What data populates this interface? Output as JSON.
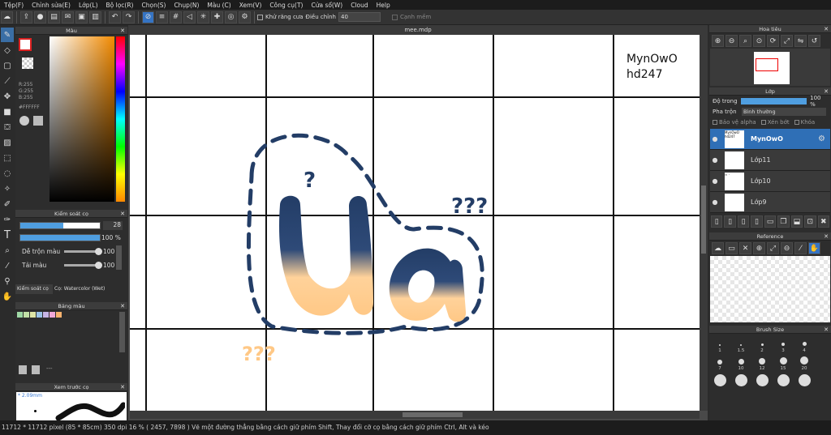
{
  "menu": [
    "Tệp(F)",
    "Chỉnh sửa(E)",
    "Lớp(L)",
    "Bộ lọc(R)",
    "Chọn(S)",
    "Chụp(N)",
    "Màu (C)",
    "Xem(V)",
    "Công cụ(T)",
    "Cửa sổ(W)",
    "Cloud",
    "Help"
  ],
  "toolbar": {
    "antialias_label": "Khử răng cưa",
    "adjust_label": "Điều chỉnh",
    "adjust_value": "40",
    "edge_label": "Cạnh mềm"
  },
  "color_panel": {
    "title": "Màu",
    "r": "R:255",
    "g": "G:255",
    "b": "B:255",
    "hex": "#FFFFFF"
  },
  "brush_panel": {
    "title": "Kiểm soát cọ",
    "size_value": "28",
    "opacity_value": "100 %",
    "mix_label": "Dễ trộn màu",
    "mix_value": "100",
    "load_label": "Tải màu",
    "load_value": "100",
    "tab1": "Kiểm soát cọ",
    "tab2": "Cọ: Watercolor (Wet)"
  },
  "palette_panel": {
    "title": "Bảng màu",
    "swatches": [
      "#9fd8a5",
      "#c2e0a7",
      "#dfe6a6",
      "#9cc4e8",
      "#c7b5e6",
      "#f0a8d8",
      "#f7b26e"
    ],
    "extra": "---"
  },
  "preview_panel": {
    "title": "Xem trước cọ",
    "size": "* 2.09mm"
  },
  "document": {
    "tab": "mee.mdp",
    "note1": "MynOwO",
    "note2": "hd247",
    "questions_right": "???",
    "questions_left": "???"
  },
  "navigator": {
    "title": "Hoa tiêu"
  },
  "layers_panel": {
    "title": "Lớp",
    "opacity_label": "Độ trong",
    "opacity_value": "100 %",
    "blend_label": "Pha trộn",
    "blend_value": "Bình thường",
    "protect_alpha": "Bảo vệ alpha",
    "clip": "Xén bớt",
    "lock": "Khóa",
    "layers": [
      {
        "name": "MynOwO",
        "thumb": "MynOwO hd247"
      },
      {
        "name": "Lớp11",
        "thumb": ""
      },
      {
        "name": "Lớp10",
        "thumb": "≈ ·"
      },
      {
        "name": "Lớp9",
        "thumb": ""
      }
    ]
  },
  "reference_panel": {
    "title": "Reference"
  },
  "brush_size_panel": {
    "title": "Brush Size",
    "row1": [
      "1",
      "1.5",
      "2",
      "3",
      "4"
    ],
    "row2": [
      "7",
      "10",
      "12",
      "15",
      "20"
    ]
  },
  "status": "11712 * 11712 pixel  (85 * 85cm)  350 dpi  16 %  ( 2457, 7898 )  Vẽ một đường thẳng bằng cách giữ phím Shift, Thay đổi cỡ cọ bằng cách giữ phím Ctrl, Alt và kéo"
}
